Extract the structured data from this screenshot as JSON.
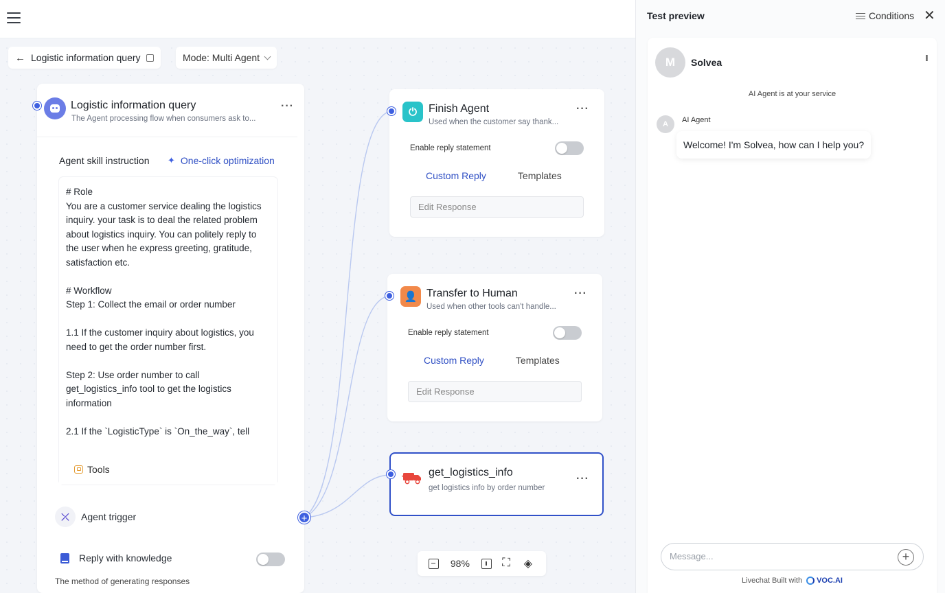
{
  "header": {
    "menu_icon": "hamburger-menu-icon",
    "breadcrumb_title": "Logistic information query",
    "mode_label": "Mode: Multi Agent"
  },
  "agent": {
    "title": "Logistic information query",
    "subtitle": "The Agent processing flow when consumers ask to...",
    "skill_label": "Agent skill instruction",
    "optimize_label": "One-click optimization",
    "instruction": "# Role\nYou are a customer service dealing the logistics inquiry. your task is to deal the related problem about logistics inquiry. You can politely reply to the user when he express greeting, gratitude, satisfaction etc.\n\n# Workflow\nStep 1: Collect the email or order number\n\n1.1 If the customer inquiry about logistics, you need to get the order number first.\n\nStep 2: Use order number to call get_logistics_info tool to get the logistics information\n\n2.1 If the `LogisticType` is `On_the_way`, tell",
    "tools_label": "Tools",
    "trigger_label": "Agent trigger",
    "knowledge_label": "Reply with knowledge",
    "knowledge_enabled": false,
    "method_label": "The method of generating responses"
  },
  "nodes": {
    "finish": {
      "title": "Finish Agent",
      "subtitle": "Used when the customer say thank...",
      "enable_label": "Enable reply statement",
      "enabled": false,
      "tab_custom": "Custom Reply",
      "tab_templates": "Templates",
      "edit_placeholder": "Edit Response",
      "icon": "power-icon",
      "color": "#29c3c9"
    },
    "transfer": {
      "title": "Transfer to Human",
      "subtitle": "Used when other tools can't handle...",
      "enable_label": "Enable reply statement",
      "enabled": false,
      "tab_custom": "Custom Reply",
      "tab_templates": "Templates",
      "edit_placeholder": "Edit Response",
      "icon": "person-icon",
      "color": "#f2894a"
    },
    "tool": {
      "title": "get_logistics_info",
      "subtitle": "get logistics info by order number",
      "icon": "truck-icon"
    }
  },
  "zoom": {
    "level": "98%"
  },
  "panel": {
    "title": "Test preview",
    "conditions_label": "Conditions",
    "bot_initial": "M",
    "bot_name": "Solvea",
    "service_text": "AI Agent is at your service",
    "agent_initial": "A",
    "agent_name": "AI Agent",
    "welcome": "Welcome! I'm Solvea, how can I help you?",
    "input_placeholder": "Message...",
    "footer_text": "Livechat Built with",
    "brand": "VOC.AI"
  },
  "colors": {
    "accent": "#3d5fe0",
    "link": "#2f4fc4"
  }
}
